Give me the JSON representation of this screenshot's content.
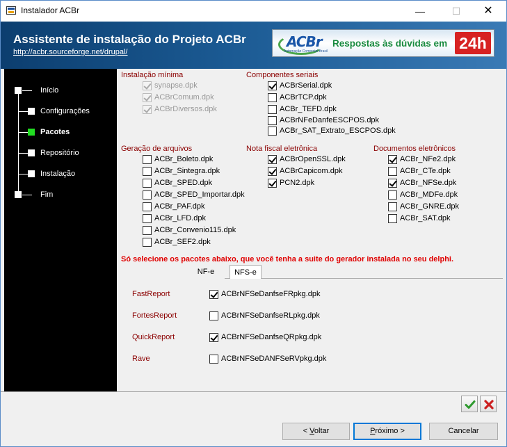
{
  "window": {
    "title": "Instalador ACBr",
    "min_glyph": "—",
    "max_glyph": "☐",
    "close_glyph": "✕"
  },
  "header": {
    "title": "Assistente de instalação do Projeto ACBr",
    "link": "http://acbr.sourceforge.net/drupal/",
    "banner_logo": "ACBr",
    "banner_logo_sub": "Automação Comercial Brasil",
    "banner_text": "Respostas às dúvidas em",
    "banner_badge": "24h"
  },
  "sidebar": {
    "items": [
      {
        "label": "Início",
        "active": false
      },
      {
        "label": "Configurações",
        "active": false
      },
      {
        "label": "Pacotes",
        "active": true
      },
      {
        "label": "Repositório",
        "active": false
      },
      {
        "label": "Instalação",
        "active": false
      },
      {
        "label": "Fim",
        "active": false
      }
    ]
  },
  "groups": {
    "minima": {
      "title": "Instalação mínima",
      "items": [
        {
          "label": "synapse.dpk",
          "checked": true,
          "disabled": true
        },
        {
          "label": "ACBrComum.dpk",
          "checked": true,
          "disabled": true
        },
        {
          "label": "ACBrDiversos.dpk",
          "checked": true,
          "disabled": true
        }
      ]
    },
    "seriais": {
      "title": "Componentes seriais",
      "items": [
        {
          "label": "ACBrSerial.dpk",
          "checked": true
        },
        {
          "label": "ACBrTCP.dpk",
          "checked": false
        },
        {
          "label": "ACBr_TEFD.dpk",
          "checked": false
        },
        {
          "label": "ACBrNFeDanfeESCPOS.dpk",
          "checked": false
        },
        {
          "label": "ACBr_SAT_Extrato_ESCPOS.dpk",
          "checked": false
        }
      ]
    },
    "arquivos": {
      "title": "Geração de arquivos",
      "items": [
        {
          "label": "ACBr_Boleto.dpk",
          "checked": false
        },
        {
          "label": "ACBr_Sintegra.dpk",
          "checked": false
        },
        {
          "label": "ACBr_SPED.dpk",
          "checked": false
        },
        {
          "label": "ACBr_SPED_Importar.dpk",
          "checked": false
        },
        {
          "label": "ACBr_PAF.dpk",
          "checked": false
        },
        {
          "label": "ACBr_LFD.dpk",
          "checked": false
        },
        {
          "label": "ACBr_Convenio115.dpk",
          "checked": false
        },
        {
          "label": "ACBr_SEF2.dpk",
          "checked": false
        }
      ]
    },
    "nfe": {
      "title": "Nota fiscal eletrônica",
      "items": [
        {
          "label": "ACBrOpenSSL.dpk",
          "checked": true
        },
        {
          "label": "ACBrCapicom.dpk",
          "checked": true
        },
        {
          "label": "PCN2.dpk",
          "checked": true
        }
      ]
    },
    "docs": {
      "title": "Documentos eletrônicos",
      "items": [
        {
          "label": "ACBr_NFe2.dpk",
          "checked": true
        },
        {
          "label": "ACBr_CTe.dpk",
          "checked": false
        },
        {
          "label": "ACBr_NFSe.dpk",
          "checked": true
        },
        {
          "label": "ACBr_MDFe.dpk",
          "checked": false
        },
        {
          "label": "ACBr_GNRE.dpk",
          "checked": false
        },
        {
          "label": "ACBr_SAT.dpk",
          "checked": false
        }
      ]
    }
  },
  "warning": "Só selecione os pacotes abaixo, que você tenha a suite do gerador instalada no seu delphi.",
  "tabs": [
    {
      "label": "NF-e",
      "active": false
    },
    {
      "label": "NFS-e",
      "active": true
    }
  ],
  "reports": [
    {
      "label": "FastReport",
      "package": "ACBrNFSeDanfseFRpkg.dpk",
      "checked": true
    },
    {
      "label": "FortesReport",
      "package": "ACBrNFSeDanfseRLpkg.dpk",
      "checked": false
    },
    {
      "label": "QuickReport",
      "package": "ACBrNFSeDanfseQRpkg.dpk",
      "checked": true
    },
    {
      "label": "Rave",
      "package": "ACBrNFSeDANFSeRVpkg.dpk",
      "checked": false
    }
  ],
  "buttons": {
    "back_prefix": "< ",
    "back_mnemonic": "V",
    "back_rest": "oltar",
    "next_mnemonic": "P",
    "next_rest": "róximo >",
    "cancel": "Cancelar"
  },
  "colors": {
    "header_dark": "#0c3e6f",
    "group_title": "#8b0000",
    "warning": "#e00000",
    "active_step": "#22dd22",
    "ok_icon": "#2e9a2e",
    "cancel_icon": "#cc1f1f"
  }
}
